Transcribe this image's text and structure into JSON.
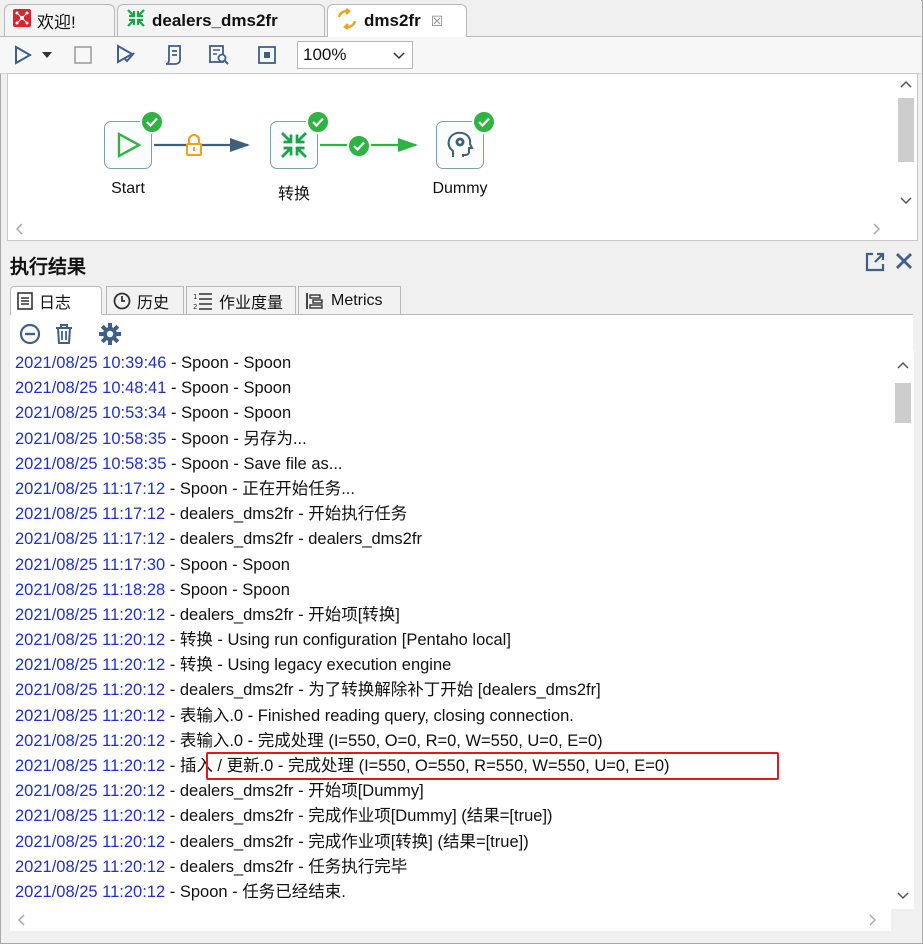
{
  "tabs": [
    {
      "label": "欢迎!",
      "icon": "spoon-logo-icon"
    },
    {
      "label": "dealers_dms2fr",
      "icon": "transformation-icon"
    },
    {
      "label": "dms2fr",
      "icon": "job-icon",
      "close": "☒"
    }
  ],
  "toolbar": {
    "zoom": "100%"
  },
  "canvas": {
    "nodes": [
      {
        "label": "Start"
      },
      {
        "label": "转换"
      },
      {
        "label": "Dummy"
      }
    ]
  },
  "panel": {
    "title": "执行结果",
    "tabs": [
      {
        "label": "日志"
      },
      {
        "label": "历史"
      },
      {
        "label": "作业度量"
      },
      {
        "label": "Metrics"
      }
    ]
  },
  "log": [
    {
      "ts": "2021/08/25 10:39:46",
      "msg": " - Spoon - Spoon"
    },
    {
      "ts": "2021/08/25 10:48:41",
      "msg": " - Spoon - Spoon"
    },
    {
      "ts": "2021/08/25 10:53:34",
      "msg": " - Spoon - Spoon"
    },
    {
      "ts": "2021/08/25 10:58:35",
      "msg": " - Spoon - 另存为..."
    },
    {
      "ts": "2021/08/25 10:58:35",
      "msg": " - Spoon - Save file as..."
    },
    {
      "ts": "2021/08/25 11:17:12",
      "msg": " - Spoon - 正在开始任务..."
    },
    {
      "ts": "2021/08/25 11:17:12",
      "msg": " - dealers_dms2fr - 开始执行任务"
    },
    {
      "ts": "2021/08/25 11:17:12",
      "msg": " - dealers_dms2fr - dealers_dms2fr"
    },
    {
      "ts": "2021/08/25 11:17:30",
      "msg": " - Spoon - Spoon"
    },
    {
      "ts": "2021/08/25 11:18:28",
      "msg": " - Spoon - Spoon"
    },
    {
      "ts": "2021/08/25 11:20:12",
      "msg": " - dealers_dms2fr - 开始项[转换]"
    },
    {
      "ts": "2021/08/25 11:20:12",
      "msg": " - 转换 - Using run configuration [Pentaho local]"
    },
    {
      "ts": "2021/08/25 11:20:12",
      "msg": " - 转换 - Using legacy execution engine"
    },
    {
      "ts": "2021/08/25 11:20:12",
      "msg": " - dealers_dms2fr - 为了转换解除补丁开始  [dealers_dms2fr]"
    },
    {
      "ts": "2021/08/25 11:20:12",
      "msg": " - 表输入.0 - Finished reading query, closing connection."
    },
    {
      "ts": "2021/08/25 11:20:12",
      "msg": " - 表输入.0 - 完成处理 (I=550, O=0, R=0, W=550, U=0, E=0)"
    },
    {
      "ts": "2021/08/25 11:20:12",
      "msg": " - 插入 / 更新.0 - 完成处理 (I=550, O=550, R=550, W=550, U=0, E=0)"
    },
    {
      "ts": "2021/08/25 11:20:12",
      "msg": " - dealers_dms2fr - 开始项[Dummy]"
    },
    {
      "ts": "2021/08/25 11:20:12",
      "msg": " - dealers_dms2fr - 完成作业项[Dummy] (结果=[true])"
    },
    {
      "ts": "2021/08/25 11:20:12",
      "msg": " - dealers_dms2fr - 完成作业项[转换] (结果=[true])"
    },
    {
      "ts": "2021/08/25 11:20:12",
      "msg": " - dealers_dms2fr - 任务执行完毕"
    },
    {
      "ts": "2021/08/25 11:20:12",
      "msg": " - Spoon - 任务已经结束."
    }
  ],
  "colors": {
    "timestamp": "#1f2fd0",
    "highlight": "#e0191f",
    "success": "#2fb343",
    "hop_green": "#2fb343",
    "hop_lock": "#f0a020"
  }
}
